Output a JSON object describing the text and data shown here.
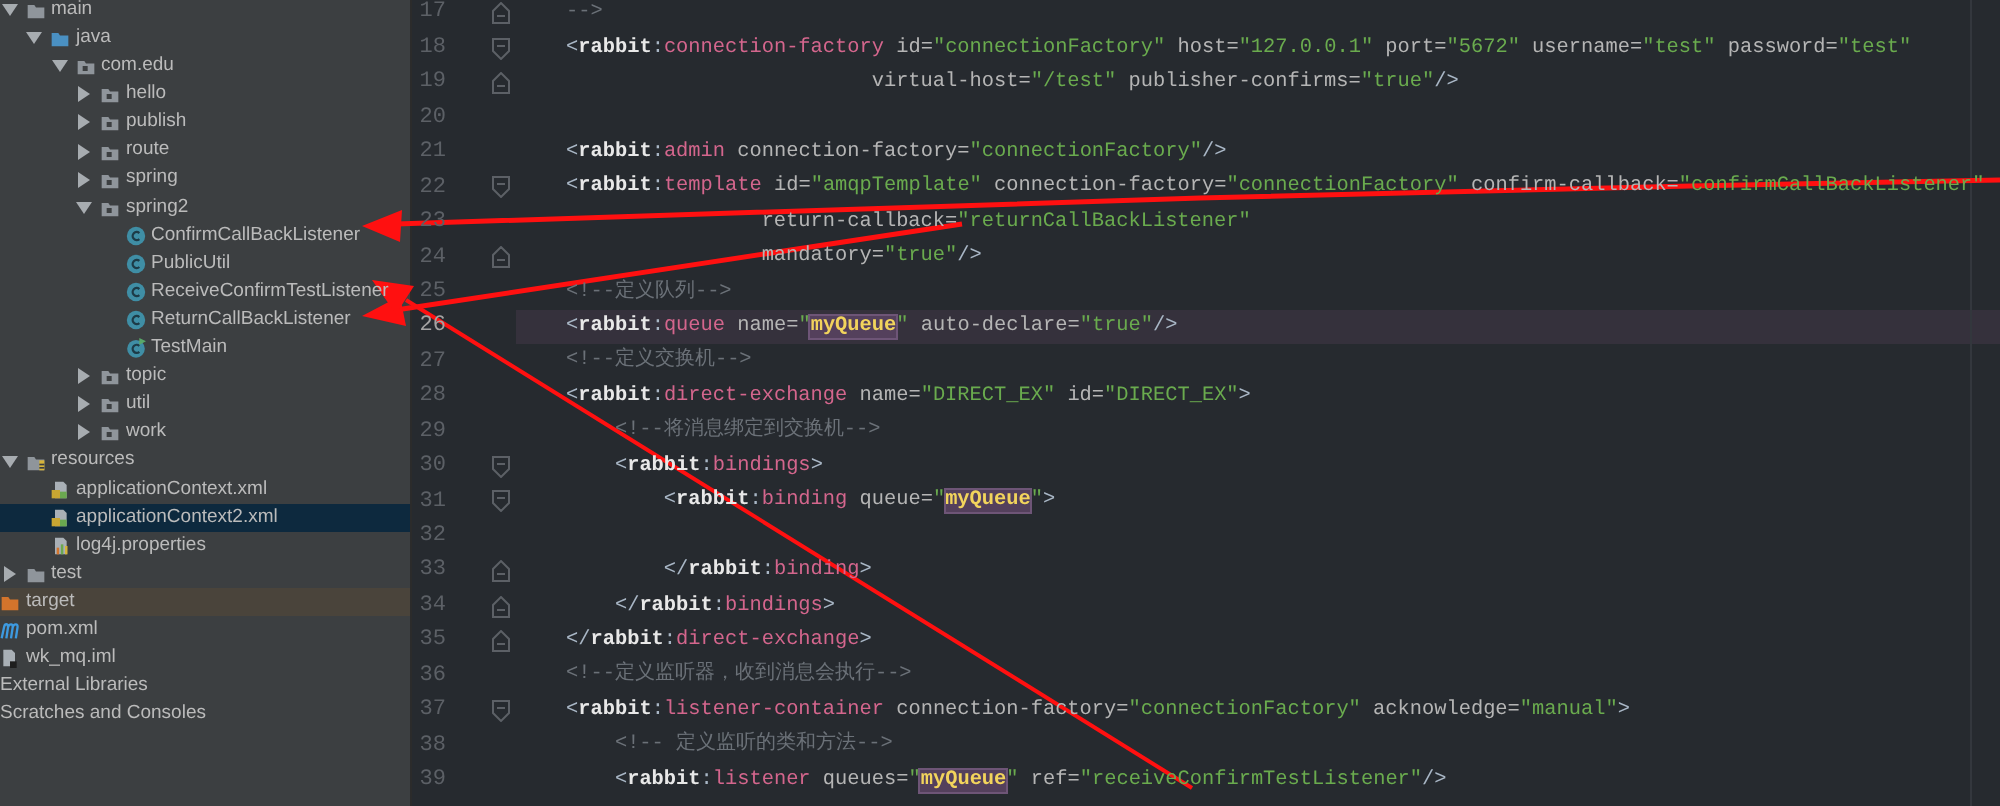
{
  "tree": {
    "source_items": [
      {
        "label": "main",
        "kind": "folder",
        "expanded": true,
        "selected": false,
        "children": [
          {
            "label": "java",
            "kind": "source-folder",
            "expanded": true,
            "selected": false,
            "children": [
              {
                "label": "com.edu",
                "kind": "package",
                "expanded": true,
                "selected": false,
                "children": [
                  {
                    "label": "hello",
                    "kind": "package",
                    "expanded": false,
                    "selected": false
                  },
                  {
                    "label": "publish",
                    "kind": "package",
                    "expanded": false,
                    "selected": false
                  },
                  {
                    "label": "route",
                    "kind": "package",
                    "expanded": false,
                    "selected": false
                  },
                  {
                    "label": "spring",
                    "kind": "package",
                    "expanded": false,
                    "selected": false
                  },
                  {
                    "label": "spring2",
                    "kind": "package",
                    "expanded": true,
                    "selected": false,
                    "children": [
                      {
                        "label": "ConfirmCallBackListener",
                        "kind": "class",
                        "selected": false
                      },
                      {
                        "label": "PublicUtil",
                        "kind": "class",
                        "selected": false
                      },
                      {
                        "label": "ReceiveConfirmTestListener",
                        "kind": "class",
                        "selected": false
                      },
                      {
                        "label": "ReturnCallBackListener",
                        "kind": "class",
                        "selected": false
                      },
                      {
                        "label": "TestMain",
                        "kind": "main-class",
                        "selected": false
                      }
                    ]
                  },
                  {
                    "label": "topic",
                    "kind": "package",
                    "expanded": false,
                    "selected": false
                  },
                  {
                    "label": "util",
                    "kind": "package",
                    "expanded": false,
                    "selected": false
                  },
                  {
                    "label": "work",
                    "kind": "package",
                    "expanded": false,
                    "selected": false
                  }
                ]
              }
            ]
          }
        ]
      },
      {
        "label": "resources",
        "kind": "resources-folder",
        "expanded": true,
        "selected": false,
        "children": [
          {
            "label": "applicationContext.xml",
            "kind": "xml",
            "selected": false
          },
          {
            "label": "applicationContext2.xml",
            "kind": "xml",
            "selected": true
          },
          {
            "label": "log4j.properties",
            "kind": "properties",
            "selected": false
          }
        ]
      },
      {
        "label": "test",
        "kind": "folder",
        "expanded": false,
        "selected": false
      }
    ],
    "module_items": [
      {
        "label": "target",
        "kind": "excluded-folder",
        "selected": false
      },
      {
        "label": "pom.xml",
        "kind": "maven",
        "selected": false
      },
      {
        "label": "wk_mq.iml",
        "kind": "iml",
        "selected": false
      },
      {
        "label": "External Libraries",
        "kind": "plain",
        "selected": false
      },
      {
        "label": "Scratches and Consoles",
        "kind": "plain",
        "selected": false
      }
    ]
  },
  "editor": {
    "lines": [
      {
        "number": "17",
        "current": false,
        "gutter": {
          "kind": "fold-end"
        },
        "tokens": [
          {
            "kind": "comment",
            "text": "-->"
          }
        ]
      },
      {
        "number": "18",
        "current": false,
        "gutter": {
          "kind": "fold-start"
        },
        "tokens": [
          {
            "kind": "punct",
            "text": "<"
          },
          {
            "kind": "ns",
            "text": "rabbit"
          },
          {
            "kind": "punct",
            "text": ":"
          },
          {
            "kind": "tag",
            "text": "connection-factory"
          },
          {
            "kind": "attr",
            "text": " id="
          },
          {
            "kind": "value",
            "text": "\"connectionFactory\""
          },
          {
            "kind": "attr",
            "text": " host="
          },
          {
            "kind": "value",
            "text": "\"127.0.0.1\""
          },
          {
            "kind": "attr",
            "text": " port="
          },
          {
            "kind": "value",
            "text": "\"5672\""
          },
          {
            "kind": "attr",
            "text": " username="
          },
          {
            "kind": "value",
            "text": "\"test\""
          },
          {
            "kind": "attr",
            "text": " password="
          },
          {
            "kind": "value",
            "text": "\"test\""
          }
        ]
      },
      {
        "number": "19",
        "current": false,
        "gutter": {
          "kind": "fold-end"
        },
        "tokens": [
          {
            "kind": "attr",
            "text": "                         virtual-host="
          },
          {
            "kind": "value",
            "text": "\"/test\""
          },
          {
            "kind": "attr",
            "text": " publisher-confirms="
          },
          {
            "kind": "value",
            "text": "\"true\""
          },
          {
            "kind": "punct",
            "text": "/>"
          }
        ]
      },
      {
        "number": "20",
        "current": false
      },
      {
        "number": "21",
        "current": false,
        "tokens": [
          {
            "kind": "punct",
            "text": "<"
          },
          {
            "kind": "ns",
            "text": "rabbit"
          },
          {
            "kind": "punct",
            "text": ":"
          },
          {
            "kind": "tag",
            "text": "admin"
          },
          {
            "kind": "attr",
            "text": " connection-factory="
          },
          {
            "kind": "value",
            "text": "\"connectionFactory\""
          },
          {
            "kind": "punct",
            "text": "/>"
          }
        ]
      },
      {
        "number": "22",
        "current": false,
        "gutter": {
          "kind": "fold-start"
        },
        "tokens": [
          {
            "kind": "punct",
            "text": "<"
          },
          {
            "kind": "ns",
            "text": "rabbit"
          },
          {
            "kind": "punct",
            "text": ":"
          },
          {
            "kind": "tag",
            "text": "template"
          },
          {
            "kind": "attr",
            "text": " id="
          },
          {
            "kind": "value",
            "text": "\"amqpTemplate\""
          },
          {
            "kind": "attr",
            "text": " connection-factory="
          },
          {
            "kind": "value",
            "text": "\"connectionFactory\""
          },
          {
            "kind": "attr",
            "text": " confirm-callback="
          },
          {
            "kind": "value",
            "text": "\"confirmCallBackListener\""
          }
        ]
      },
      {
        "number": "23",
        "current": false,
        "tokens": [
          {
            "kind": "attr",
            "text": "                return-callback="
          },
          {
            "kind": "value",
            "text": "\"returnCallBackListener\""
          }
        ]
      },
      {
        "number": "24",
        "current": false,
        "gutter": {
          "kind": "fold-end"
        },
        "tokens": [
          {
            "kind": "attr",
            "text": "                mandatory="
          },
          {
            "kind": "value",
            "text": "\"true\""
          },
          {
            "kind": "punct",
            "text": "/>"
          }
        ]
      },
      {
        "number": "25",
        "current": false,
        "tokens": [
          {
            "kind": "comment",
            "text": "<!--定义队列-->"
          }
        ]
      },
      {
        "number": "26",
        "current": true,
        "tokens": [
          {
            "kind": "punct",
            "text": "<"
          },
          {
            "kind": "ns",
            "text": "rabbit"
          },
          {
            "kind": "punct",
            "text": ":"
          },
          {
            "kind": "tag",
            "text": "queue"
          },
          {
            "kind": "attr",
            "text": " name="
          },
          {
            "kind": "value",
            "text": "\""
          },
          {
            "kind": "highlight",
            "text": "myQueue"
          },
          {
            "kind": "value",
            "text": "\""
          },
          {
            "kind": "attr",
            "text": " auto-declare="
          },
          {
            "kind": "value",
            "text": "\"true\""
          },
          {
            "kind": "punct",
            "text": "/>"
          }
        ]
      },
      {
        "number": "27",
        "current": false,
        "tokens": [
          {
            "kind": "comment",
            "text": "<!--定义交换机-->"
          }
        ]
      },
      {
        "number": "28",
        "current": false,
        "tokens": [
          {
            "kind": "punct",
            "text": "<"
          },
          {
            "kind": "ns",
            "text": "rabbit"
          },
          {
            "kind": "punct",
            "text": ":"
          },
          {
            "kind": "tag",
            "text": "direct-exchange"
          },
          {
            "kind": "attr",
            "text": " name="
          },
          {
            "kind": "value",
            "text": "\"DIRECT_EX\""
          },
          {
            "kind": "attr",
            "text": " id="
          },
          {
            "kind": "value",
            "text": "\"DIRECT_EX\""
          },
          {
            "kind": "punct",
            "text": ">"
          }
        ]
      },
      {
        "number": "29",
        "current": false,
        "tokens": [
          {
            "kind": "comment",
            "text": "    <!--将消息绑定到交换机-->"
          }
        ]
      },
      {
        "number": "30",
        "current": false,
        "gutter": {
          "kind": "fold-start"
        },
        "tokens": [
          {
            "kind": "punct",
            "text": "    <"
          },
          {
            "kind": "ns",
            "text": "rabbit"
          },
          {
            "kind": "punct",
            "text": ":"
          },
          {
            "kind": "tag",
            "text": "bindings"
          },
          {
            "kind": "punct",
            "text": ">"
          }
        ]
      },
      {
        "number": "31",
        "current": false,
        "gutter": {
          "kind": "fold-start"
        },
        "tokens": [
          {
            "kind": "punct",
            "text": "        <"
          },
          {
            "kind": "ns",
            "text": "rabbit"
          },
          {
            "kind": "punct",
            "text": ":"
          },
          {
            "kind": "tag",
            "text": "binding"
          },
          {
            "kind": "attr",
            "text": " queue="
          },
          {
            "kind": "value",
            "text": "\""
          },
          {
            "kind": "highlight",
            "text": "myQueue"
          },
          {
            "kind": "value",
            "text": "\""
          },
          {
            "kind": "punct",
            "text": ">"
          }
        ]
      },
      {
        "number": "32",
        "current": false
      },
      {
        "number": "33",
        "current": false,
        "gutter": {
          "kind": "fold-end"
        },
        "tokens": [
          {
            "kind": "punct",
            "text": "        </"
          },
          {
            "kind": "ns",
            "text": "rabbit"
          },
          {
            "kind": "punct",
            "text": ":"
          },
          {
            "kind": "tag",
            "text": "binding"
          },
          {
            "kind": "punct",
            "text": ">"
          }
        ]
      },
      {
        "number": "34",
        "current": false,
        "gutter": {
          "kind": "fold-end"
        },
        "tokens": [
          {
            "kind": "punct",
            "text": "    </"
          },
          {
            "kind": "ns",
            "text": "rabbit"
          },
          {
            "kind": "punct",
            "text": ":"
          },
          {
            "kind": "tag",
            "text": "bindings"
          },
          {
            "kind": "punct",
            "text": ">"
          }
        ]
      },
      {
        "number": "35",
        "current": false,
        "gutter": {
          "kind": "fold-end"
        },
        "tokens": [
          {
            "kind": "punct",
            "text": "</"
          },
          {
            "kind": "ns",
            "text": "rabbit"
          },
          {
            "kind": "punct",
            "text": ":"
          },
          {
            "kind": "tag",
            "text": "direct-exchange"
          },
          {
            "kind": "punct",
            "text": ">"
          }
        ]
      },
      {
        "number": "36",
        "current": false,
        "tokens": [
          {
            "kind": "comment",
            "text": "<!--定义监听器，收到消息会执行-->"
          }
        ]
      },
      {
        "number": "37",
        "current": false,
        "gutter": {
          "kind": "fold-start"
        },
        "tokens": [
          {
            "kind": "punct",
            "text": "<"
          },
          {
            "kind": "ns",
            "text": "rabbit"
          },
          {
            "kind": "punct",
            "text": ":"
          },
          {
            "kind": "tag",
            "text": "listener-container"
          },
          {
            "kind": "attr",
            "text": " connection-factory="
          },
          {
            "kind": "value",
            "text": "\"connectionFactory\""
          },
          {
            "kind": "attr",
            "text": " acknowledge="
          },
          {
            "kind": "value",
            "text": "\"manual\""
          },
          {
            "kind": "punct",
            "text": ">"
          }
        ]
      },
      {
        "number": "38",
        "current": false,
        "tokens": [
          {
            "kind": "comment",
            "text": "    <!-- 定义监听的类和方法-->"
          }
        ]
      },
      {
        "number": "39",
        "current": false,
        "tokens": [
          {
            "kind": "punct",
            "text": "    <"
          },
          {
            "kind": "ns",
            "text": "rabbit"
          },
          {
            "kind": "punct",
            "text": ":"
          },
          {
            "kind": "tag",
            "text": "listener"
          },
          {
            "kind": "attr",
            "text": " queues="
          },
          {
            "kind": "value",
            "text": "\""
          },
          {
            "kind": "highlight",
            "text": "myQueue"
          },
          {
            "kind": "value",
            "text": "\""
          },
          {
            "kind": "attr",
            "text": " ref="
          },
          {
            "kind": "value",
            "text": "\"receiveConfirmTestListener\""
          },
          {
            "kind": "punct",
            "text": "/>"
          }
        ]
      }
    ]
  }
}
